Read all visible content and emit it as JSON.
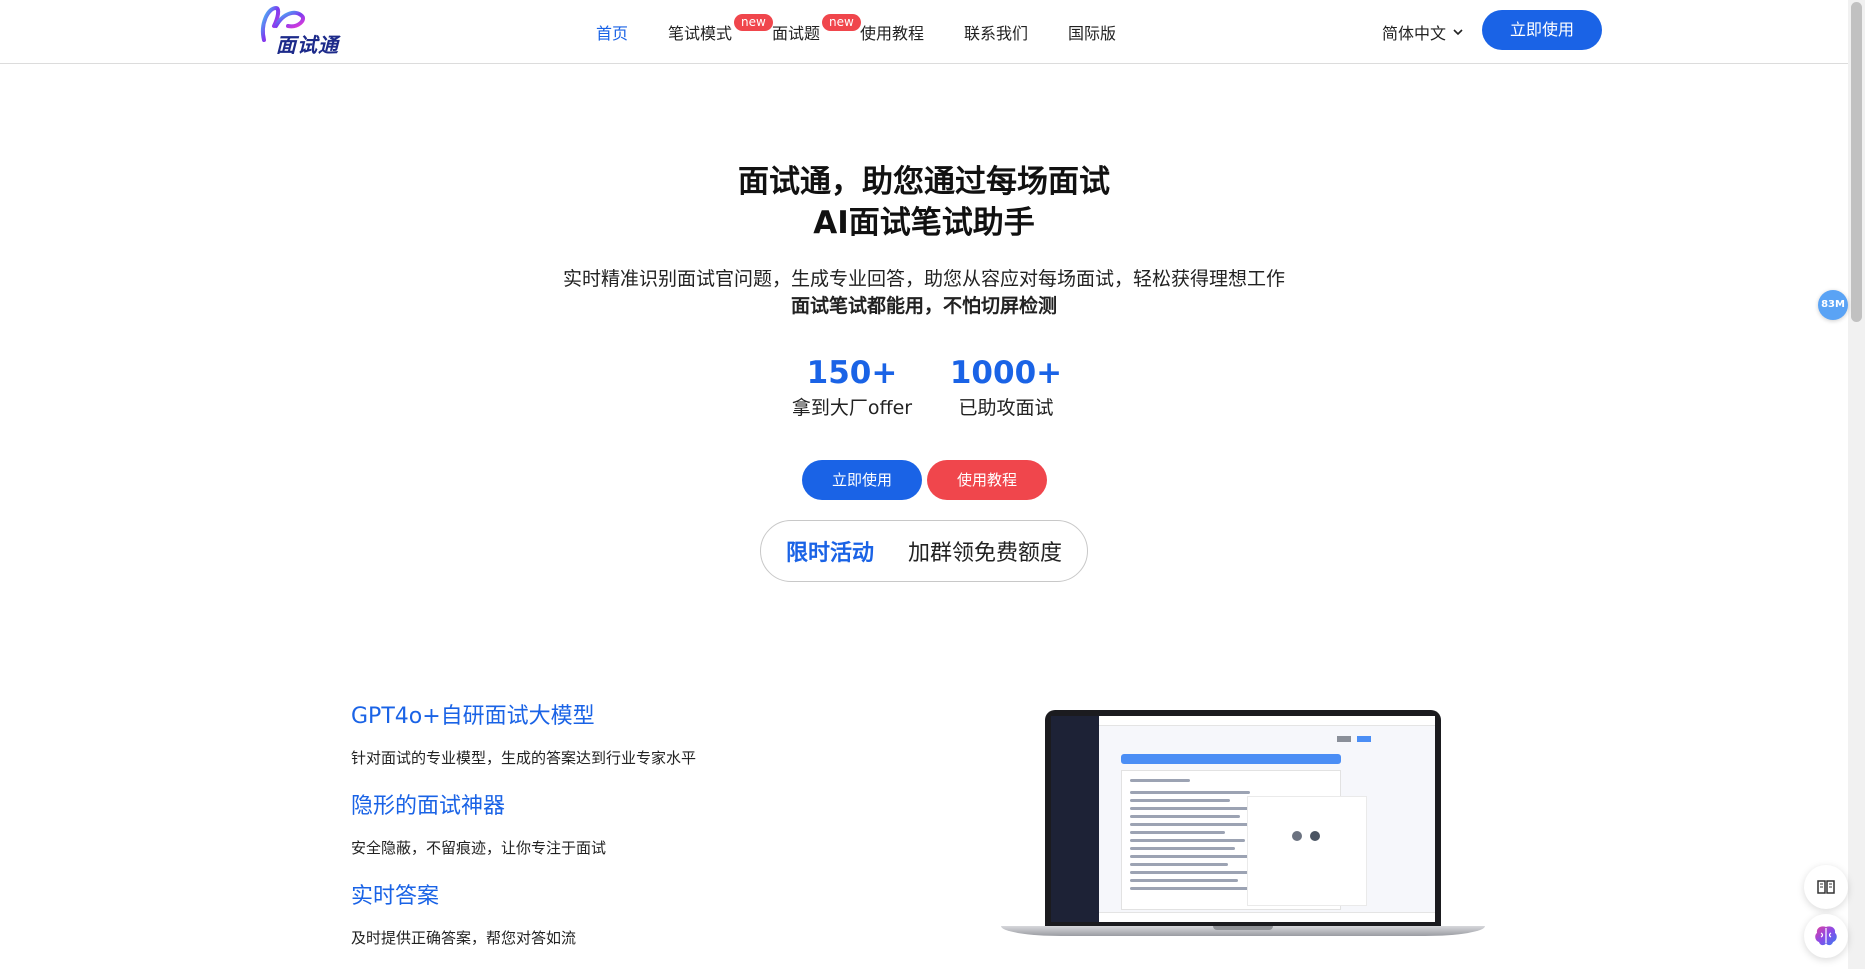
{
  "header": {
    "logo_text": "面试通",
    "nav": [
      {
        "label": "首页",
        "active": true
      },
      {
        "label": "笔试模式",
        "badge": "new"
      },
      {
        "label": "面试题",
        "badge": "new"
      },
      {
        "label": "使用教程"
      },
      {
        "label": "联系我们"
      },
      {
        "label": "国际版"
      }
    ],
    "language": "简体中文",
    "cta_label": "立即使用"
  },
  "hero": {
    "title_line1": "面试通，助您通过每场面试",
    "title_line2": "AI面试笔试助手",
    "subtitle": "实时精准识别面试官问题，生成专业回答，助您从容应对每场面试，轻松获得理想工作",
    "subtitle_bold": "面试笔试都能用，不怕切屏检测",
    "stats": [
      {
        "value": "150+",
        "label": "拿到大厂offer"
      },
      {
        "value": "1000+",
        "label": "已助攻面试"
      }
    ],
    "buttons": {
      "primary": "立即使用",
      "secondary": "使用教程"
    },
    "promo": {
      "tag": "限时活动",
      "text": "加群领免费额度"
    }
  },
  "features": [
    {
      "title": "GPT4o+自研面试大模型",
      "desc": "针对面试的专业模型，生成的答案达到行业专家水平"
    },
    {
      "title": "隐形的面试神器",
      "desc": "安全隐蔽，不留痕迹，让你专注于面试"
    },
    {
      "title": "实时答案",
      "desc": "及时提供正确答案，帮您对答如流"
    }
  ],
  "widgets": {
    "memory_badge": "83M"
  },
  "colors": {
    "accent": "#1a63e6",
    "danger": "#f0464c",
    "text": "#222222"
  },
  "icons": {
    "language_dropdown": "chevron-down-icon",
    "reader": "book-open-icon",
    "assistant": "brain-icon"
  }
}
